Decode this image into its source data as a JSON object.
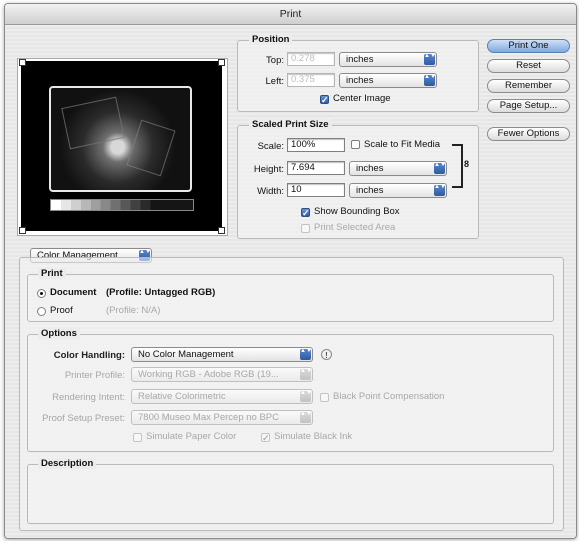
{
  "window": {
    "title": "Print"
  },
  "buttons": {
    "print_one": "Print One",
    "reset": "Reset",
    "remember": "Remember",
    "page_setup": "Page Setup...",
    "fewer_options": "Fewer Options"
  },
  "position": {
    "group_label": "Position",
    "top_label": "Top:",
    "top_value": "0.278",
    "top_unit": "inches",
    "left_label": "Left:",
    "left_value": "0.375",
    "left_unit": "inches",
    "center_image_label": "Center Image",
    "center_image_checked": true
  },
  "scaled_print_size": {
    "group_label": "Scaled Print Size",
    "scale_label": "Scale:",
    "scale_value": "100%",
    "scale_to_fit_label": "Scale to Fit Media",
    "scale_to_fit_checked": false,
    "height_label": "Height:",
    "height_value": "7.694",
    "height_unit": "inches",
    "width_label": "Width:",
    "width_value": "10",
    "width_unit": "inches",
    "show_bounding_box_label": "Show Bounding Box",
    "show_bounding_box_checked": true,
    "print_selected_area_label": "Print Selected Area",
    "print_selected_area_checked": false
  },
  "section_popup": {
    "selected": "Color Management"
  },
  "print_group": {
    "label": "Print",
    "document_label": "Document",
    "document_profile": "(Profile: Untagged RGB)",
    "document_selected": true,
    "proof_label": "Proof",
    "proof_profile": "(Profile: N/A)",
    "proof_selected": false
  },
  "options_group": {
    "label": "Options",
    "color_handling_label": "Color Handling:",
    "color_handling_value": "No Color Management",
    "printer_profile_label": "Printer Profile:",
    "printer_profile_value": "Working RGB - Adobe RGB (19...",
    "rendering_intent_label": "Rendering Intent:",
    "rendering_intent_value": "Relative Colorimetric",
    "black_point_label": "Black Point Compensation",
    "proof_setup_label": "Proof Setup Preset:",
    "proof_setup_value": "7800 Museo Max Percep no BPC",
    "simulate_paper_label": "Simulate Paper Color",
    "simulate_paper_checked": false,
    "simulate_black_label": "Simulate Black Ink",
    "simulate_black_checked": true
  },
  "description_group": {
    "label": "Description"
  },
  "icons": {
    "check": "✓",
    "arrows": "▲▼",
    "info": "!",
    "link": "8"
  }
}
